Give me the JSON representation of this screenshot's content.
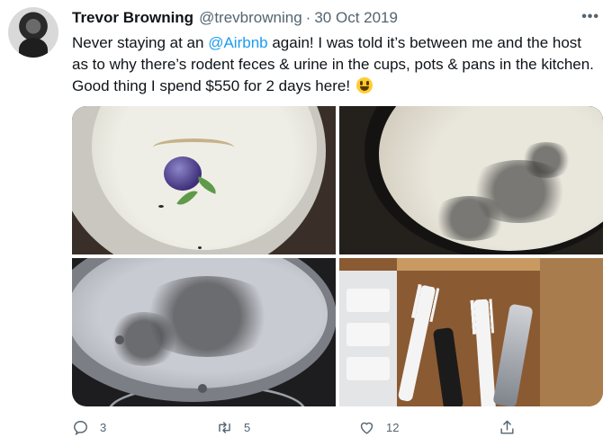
{
  "tweet": {
    "author_name": "Trevor Browning",
    "handle": "@trevbrowning",
    "separator": "·",
    "date": "30 Oct 2019",
    "more_label": "•••",
    "text_before": "Never staying at an ",
    "mention": "@Airbnb",
    "text_after": " again! I was told it’s between me and the host as to why there’s rodent feces & urine in the cups, pots & pans in the kitchen. Good thing I spend $550 for 2 days here! ",
    "emoji": "grinning-face-emoji"
  },
  "actions": {
    "reply_count": "3",
    "retweet_count": "5",
    "like_count": "12",
    "share_label": ""
  },
  "colors": {
    "link": "#1d9bf0",
    "secondary_text": "#536471",
    "primary_text": "#0f1419"
  }
}
